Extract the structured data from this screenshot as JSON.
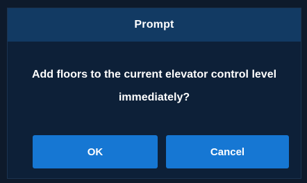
{
  "dialog": {
    "title": "Prompt",
    "message": "Add floors to the current elevator control level immediately?",
    "ok_label": "OK",
    "cancel_label": "Cancel",
    "colors": {
      "background": "#0d2038",
      "title_bar": "#123a63",
      "button": "#1677d3",
      "text": "#ffffff"
    }
  }
}
